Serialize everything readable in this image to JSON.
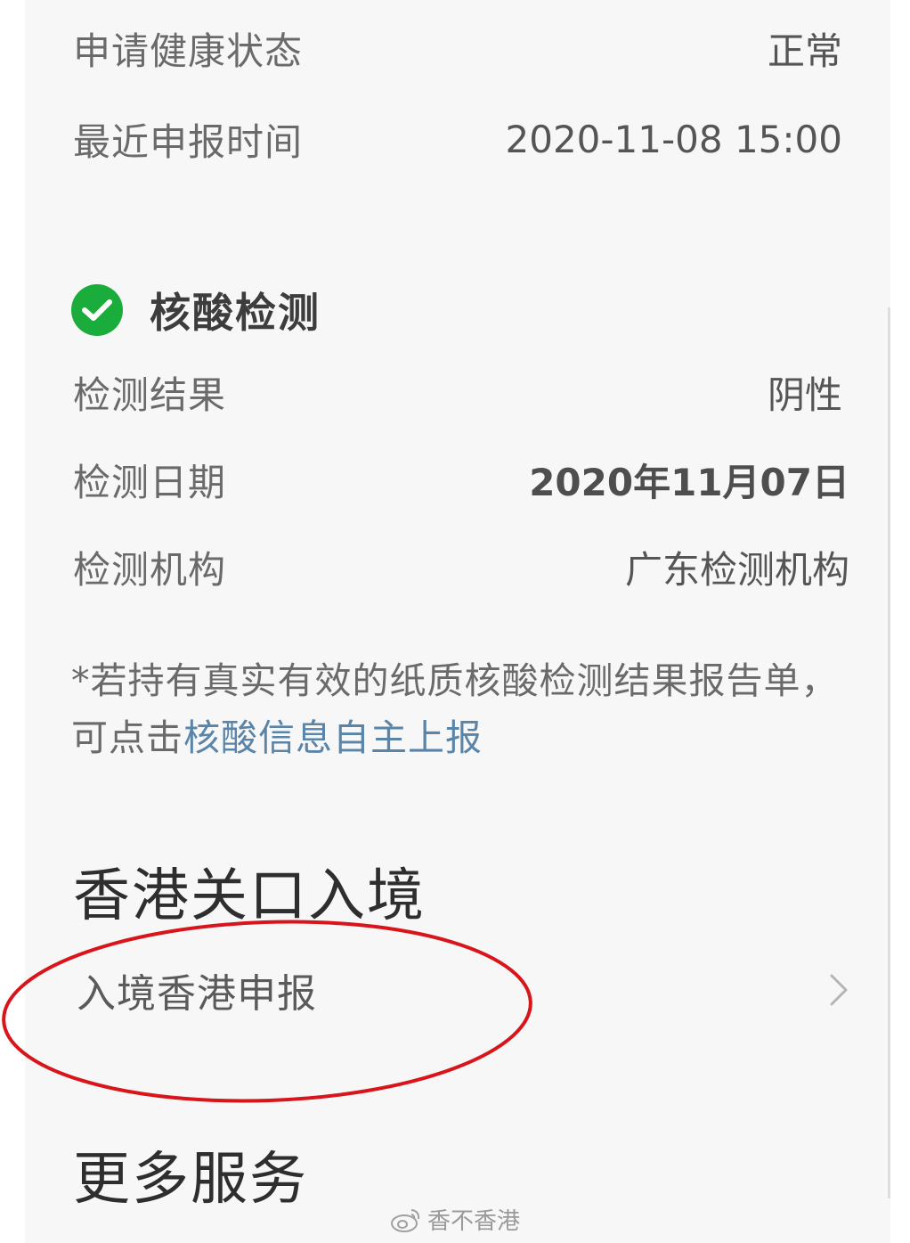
{
  "health": {
    "status_label": "申请健康状态",
    "status_value": "正常",
    "report_time_label": "最近申报时间",
    "report_time_value": "2020-11-08 15:00"
  },
  "nucleic": {
    "title": "核酸检测",
    "result_label": "检测结果",
    "result_value": "阴性",
    "date_label": "检测日期",
    "date_value": "2020年11月07日",
    "org_label": "检测机构",
    "org_value": "广东检测机构",
    "note_text": "*若持有真实有效的纸质核酸检测结果报告单，可点击",
    "note_link": "核酸信息自主上报"
  },
  "hk_entry": {
    "section_title": "香港关口入境",
    "declare_label": "入境香港申报"
  },
  "more": {
    "section_title": "更多服务"
  },
  "watermark": {
    "text": "香不香港"
  },
  "colors": {
    "check_green": "#1aad3b",
    "link_blue": "#5a84a8",
    "annotation_red": "#d9151c"
  }
}
